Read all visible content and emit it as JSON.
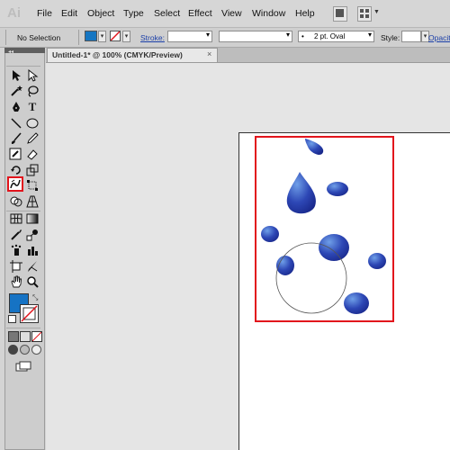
{
  "app": {
    "logo": "Ai"
  },
  "menubar": {
    "items": [
      "File",
      "Edit",
      "Object",
      "Type",
      "Select",
      "Effect",
      "View",
      "Window",
      "Help"
    ]
  },
  "controlbar": {
    "selection_status": "No Selection",
    "stroke_label": "Stroke:",
    "stroke_weight": "",
    "brush": "2 pt. Oval",
    "style_label": "Style:",
    "opacity_label": "Opacity",
    "fill_color": "#1676c2"
  },
  "document": {
    "tab_title": "Untitled-1* @ 100% (CMYK/Preview)",
    "tab_close": "×"
  },
  "tools": {
    "selected": "blob-brush-tool",
    "fill_color": "#1673c4",
    "stroke_color": "#ffffff",
    "icons": [
      "selection-tool",
      "direct-selection-tool",
      "magic-wand-tool",
      "lasso-tool",
      "pen-tool",
      "type-tool",
      "line-tool",
      "ellipse-tool",
      "paintbrush-tool",
      "pencil-tool",
      "blob-brush-tool",
      "eraser-tool",
      "rotate-tool",
      "scale-tool",
      "warp-tool",
      "free-transform-tool",
      "shape-builder-tool",
      "perspective-grid-tool",
      "mesh-tool",
      "gradient-tool",
      "eyedropper-tool",
      "blend-tool",
      "symbol-sprayer-tool",
      "column-graph-tool",
      "artboard-tool",
      "slice-tool",
      "hand-tool",
      "zoom-tool"
    ]
  },
  "colors": {
    "highlight": "#e2141c",
    "drop_dark": "#1a2a8c",
    "drop_light": "#5a8fe0"
  }
}
